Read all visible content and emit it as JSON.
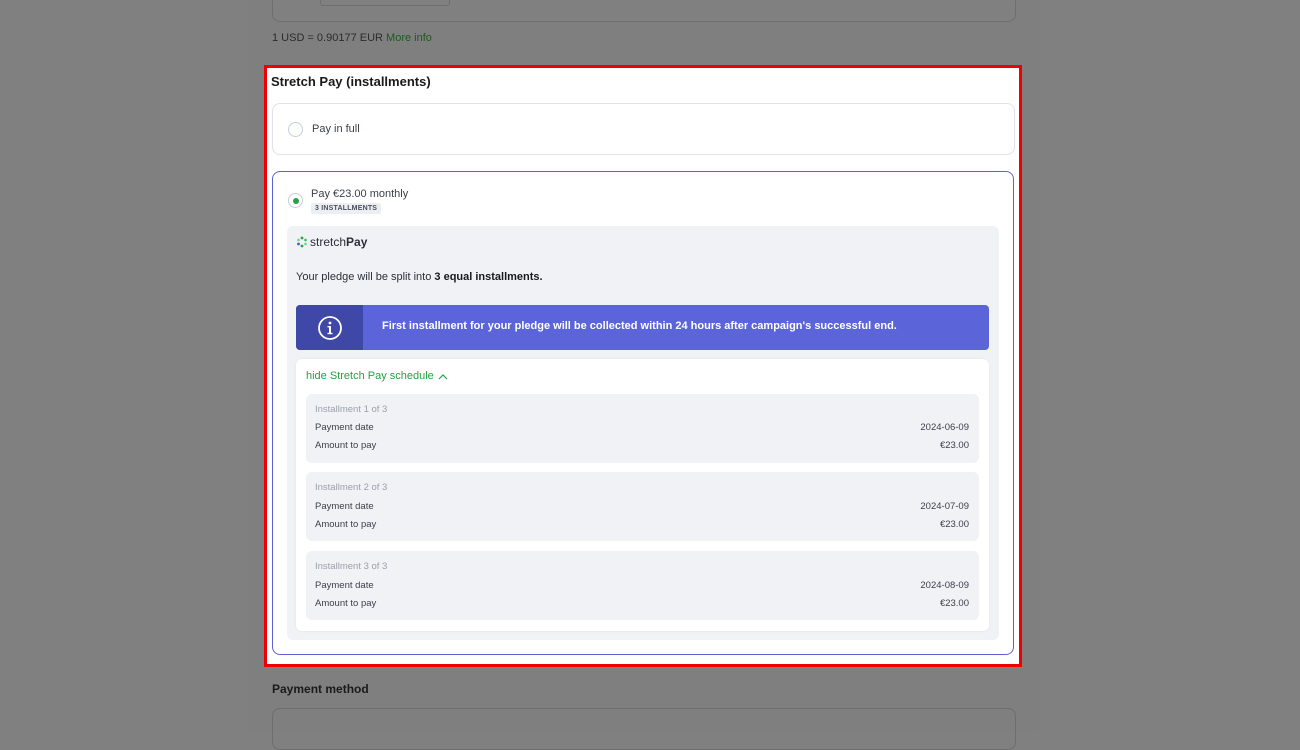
{
  "exchange": {
    "rate_text": "1 USD = 0.90177 EUR",
    "more_info_label": "More info"
  },
  "stretch_pay": {
    "section_title": "Stretch Pay (installments)",
    "pay_in_full_label": "Pay in full",
    "monthly_label": "Pay €23.00 monthly",
    "installments_badge": "3 INSTALLMENTS",
    "logo_light": "stretch",
    "logo_bold": "Pay",
    "split_text_prefix": "Your pledge will be split into ",
    "split_text_bold": "3 equal installments.",
    "info_message": "First installment for your pledge will be collected within 24 hours after campaign's successful end.",
    "hide_schedule_label": "hide Stretch Pay schedule",
    "payment_date_label": "Payment date",
    "amount_label": "Amount to pay",
    "installments": [
      {
        "title": "Installment 1 of 3",
        "date": "2024-06-09",
        "amount": "€23.00"
      },
      {
        "title": "Installment 2 of 3",
        "date": "2024-07-09",
        "amount": "€23.00"
      },
      {
        "title": "Installment 3 of 3",
        "date": "2024-08-09",
        "amount": "€23.00"
      }
    ]
  },
  "payment_method": {
    "title": "Payment method"
  },
  "colors": {
    "accent_green": "#25a244",
    "info_blue": "#5b64d9",
    "info_icon_bg": "#3f47a7",
    "highlight_red": "#ee0000"
  }
}
